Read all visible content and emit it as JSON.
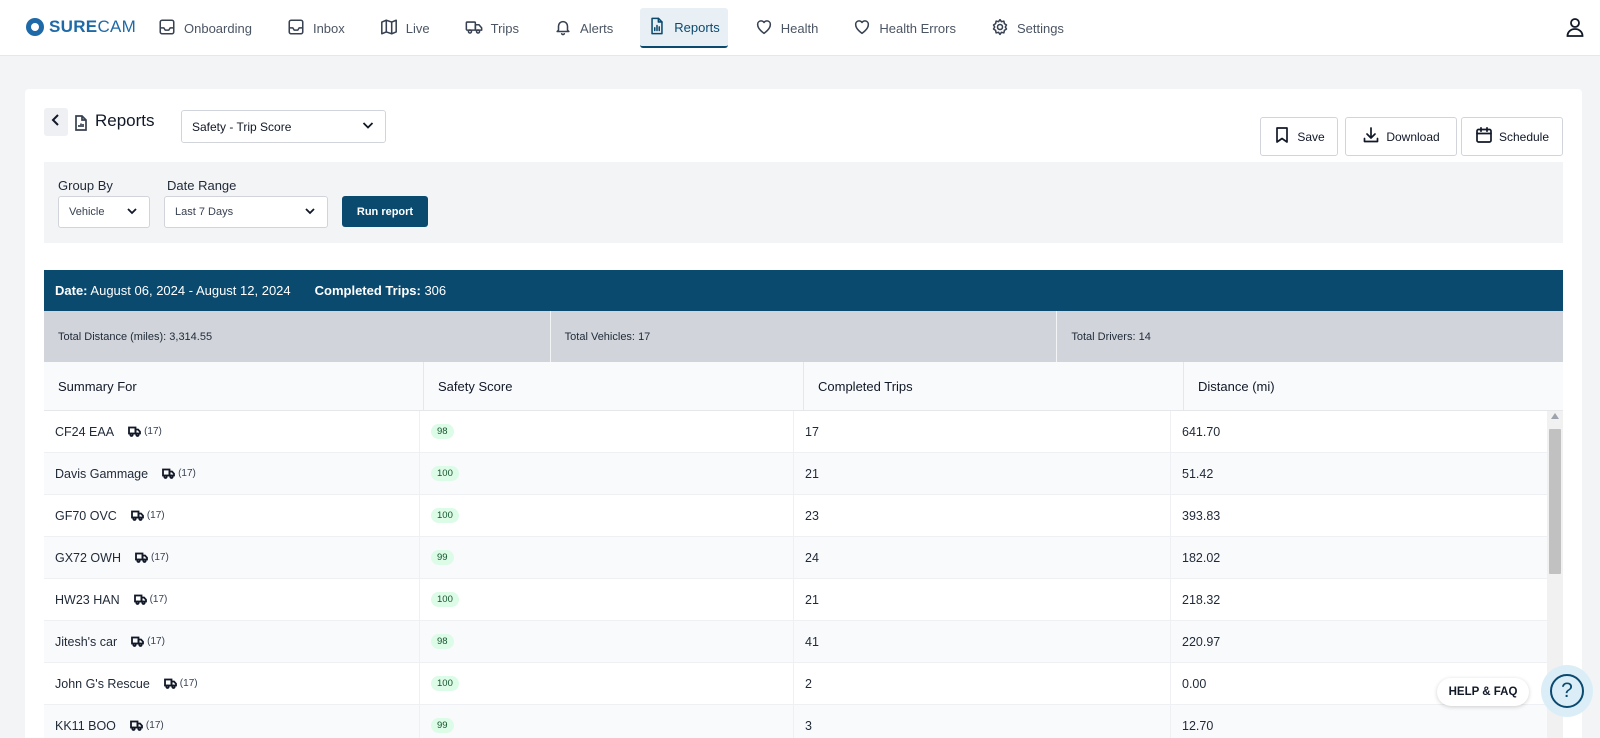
{
  "app": {
    "logo_bold": "SURE",
    "logo_rest": "CAM"
  },
  "nav": [
    {
      "label": "Onboarding",
      "icon": "inbox-icon"
    },
    {
      "label": "Inbox",
      "icon": "inbox-icon"
    },
    {
      "label": "Live",
      "icon": "map-icon"
    },
    {
      "label": "Trips",
      "icon": "truck-icon"
    },
    {
      "label": "Alerts",
      "icon": "bell-icon"
    },
    {
      "label": "Reports",
      "icon": "document-chart-icon",
      "active": true
    },
    {
      "label": "Health",
      "icon": "heart-icon"
    },
    {
      "label": "Health Errors",
      "icon": "heart-icon"
    },
    {
      "label": "Settings",
      "icon": "gear-icon"
    }
  ],
  "page": {
    "title": "Reports",
    "report_type": "Safety - Trip Score"
  },
  "actions": {
    "save": "Save",
    "download": "Download",
    "schedule": "Schedule"
  },
  "filters": {
    "group_by_label": "Group By",
    "group_by_value": "Vehicle",
    "date_range_label": "Date Range",
    "date_range_value": "Last 7 Days",
    "run_label": "Run report"
  },
  "summary": {
    "date_label": "Date:",
    "date_value": "August 06, 2024 - August 12, 2024",
    "trips_label": "Completed Trips:",
    "trips_value": "306"
  },
  "totals": {
    "distance_label": "Total Distance (miles):",
    "distance_value": "3,314.55",
    "vehicles_label": "Total Vehicles:",
    "vehicles_value": "17",
    "drivers_label": "Total Drivers:",
    "drivers_value": "14"
  },
  "table": {
    "headers": [
      "Summary For",
      "Safety Score",
      "Completed Trips",
      "Distance (mi)"
    ],
    "rows": [
      {
        "name": "CF24 EAA",
        "count": "(17)",
        "score": "98",
        "trips": "17",
        "distance": "641.70"
      },
      {
        "name": "Davis Gammage",
        "count": "(17)",
        "score": "100",
        "trips": "21",
        "distance": "51.42"
      },
      {
        "name": "GF70 OVC",
        "count": "(17)",
        "score": "100",
        "trips": "23",
        "distance": "393.83"
      },
      {
        "name": "GX72 OWH",
        "count": "(17)",
        "score": "99",
        "trips": "24",
        "distance": "182.02"
      },
      {
        "name": "HW23 HAN",
        "count": "(17)",
        "score": "100",
        "trips": "21",
        "distance": "218.32"
      },
      {
        "name": "Jitesh's car",
        "count": "(17)",
        "score": "98",
        "trips": "41",
        "distance": "220.97"
      },
      {
        "name": "John G's Rescue",
        "count": "(17)",
        "score": "100",
        "trips": "2",
        "distance": "0.00"
      },
      {
        "name": "KK11 BOO",
        "count": "(17)",
        "score": "99",
        "trips": "3",
        "distance": "12.70"
      }
    ]
  },
  "help": {
    "label": "HELP & FAQ",
    "glyph": "?"
  },
  "colors": {
    "primary": "#0b4a6f",
    "badge_bg": "#dcfce7",
    "badge_text": "#14532d"
  }
}
